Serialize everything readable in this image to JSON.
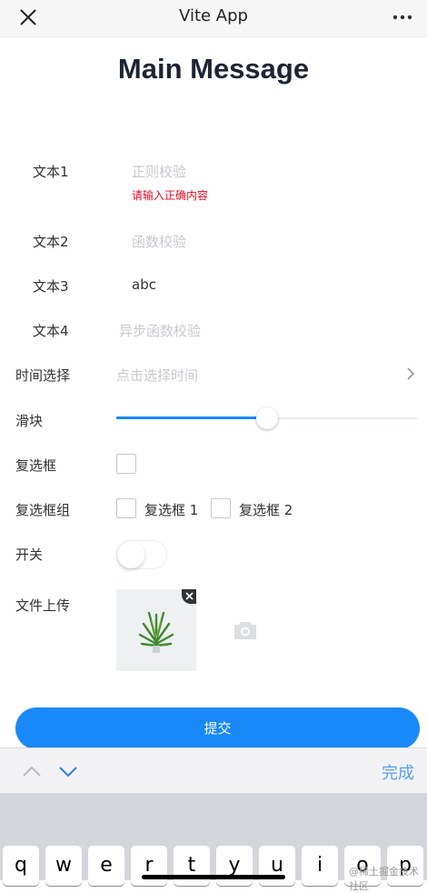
{
  "topbar": {
    "title": "Vite App"
  },
  "heading": "Main Message",
  "form": {
    "text1": {
      "label": "文本1",
      "placeholder": "正则校验",
      "error": "请输入正确内容"
    },
    "text2": {
      "label": "文本2",
      "placeholder": "函数校验"
    },
    "text3": {
      "label": "文本3",
      "value": "abc"
    },
    "text4": {
      "label": "文本4",
      "placeholder": "异步函数校验"
    },
    "time": {
      "label": "时间选择",
      "placeholder": "点击选择时间"
    },
    "slider": {
      "label": "滑块",
      "value": 0.5
    },
    "checkbox": {
      "label": "复选框"
    },
    "checkbox_group": {
      "label": "复选框组",
      "options": [
        "复选框 1",
        "复选框 2"
      ]
    },
    "switch": {
      "label": "开关"
    },
    "upload": {
      "label": "文件上传"
    },
    "submit_label": "提交"
  },
  "keyboard_toolbar": {
    "done_label": "完成"
  },
  "keyboard": {
    "keys": [
      "q",
      "w",
      "e",
      "r",
      "t",
      "y",
      "u",
      "i",
      "o",
      "p"
    ]
  },
  "watermark": "@稀土掘金技术社区",
  "colors": {
    "primary": "#1989fa",
    "error": "#ee0a24",
    "placeholder": "#c8c9cc"
  }
}
